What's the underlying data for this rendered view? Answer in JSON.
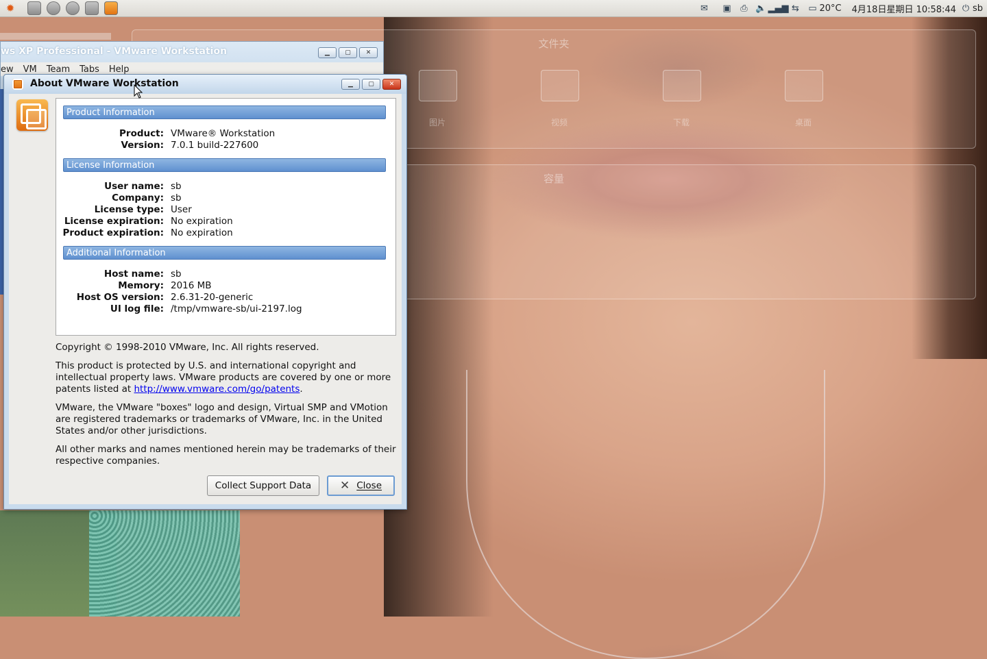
{
  "panel": {
    "launcher_icon": "ubuntu-logo-icon",
    "temperature": "20°C",
    "datetime": "4月18日星期日 10:58:44",
    "user": "sb"
  },
  "desktop": {
    "widget_folders_title": "文件夹",
    "widget_capacity_title": "容量",
    "folders": [
      "图片",
      "视频",
      "下载",
      "桌面"
    ]
  },
  "bg_window": {
    "title": "ws XP Professional - VMware Workstation",
    "menu": [
      "ew",
      "VM",
      "Team",
      "Tabs",
      "Help"
    ]
  },
  "dialog": {
    "title": "About VMware Workstation",
    "sections": {
      "product": {
        "header": "Product Information",
        "rows": [
          {
            "label": "Product:",
            "value": "VMware® Workstation"
          },
          {
            "label": "Version:",
            "value": "7.0.1 build-227600"
          }
        ]
      },
      "license": {
        "header": "License Information",
        "rows": [
          {
            "label": "User name:",
            "value": "sb"
          },
          {
            "label": "Company:",
            "value": "sb"
          },
          {
            "label": "License type:",
            "value": "User"
          },
          {
            "label": "License expiration:",
            "value": "No expiration"
          },
          {
            "label": "Product expiration:",
            "value": "No expiration"
          }
        ]
      },
      "additional": {
        "header": "Additional Information",
        "rows": [
          {
            "label": "Host name:",
            "value": "sb"
          },
          {
            "label": "Memory:",
            "value": "2016 MB"
          },
          {
            "label": "Host OS version:",
            "value": "2.6.31-20-generic"
          },
          {
            "label": "UI log file:",
            "value": "/tmp/vmware-sb/ui-2197.log"
          }
        ]
      }
    },
    "copyright": "Copyright © 1998-2010 VMware, Inc. All rights reserved.",
    "patent_text_before": "This product is protected by U.S. and international copyright and intellectual property laws. VMware products are covered by one or more patents listed at ",
    "patent_link": "http://www.vmware.com/go/patents",
    "patent_text_after": ".",
    "trademark_text": "VMware, the VMware \"boxes\" logo and design, Virtual SMP and VMotion are registered trademarks or trademarks of VMware, Inc. in the United States and/or other jurisdictions.",
    "other_marks_text": "All other marks and names mentioned herein may be trademarks of their respective companies.",
    "buttons": {
      "collect_support": "Collect Support Data",
      "close": "Close"
    }
  },
  "colors": {
    "section_header": "#5f90cf",
    "link": "#0000ee",
    "titlebar": "#c2d6ea"
  }
}
